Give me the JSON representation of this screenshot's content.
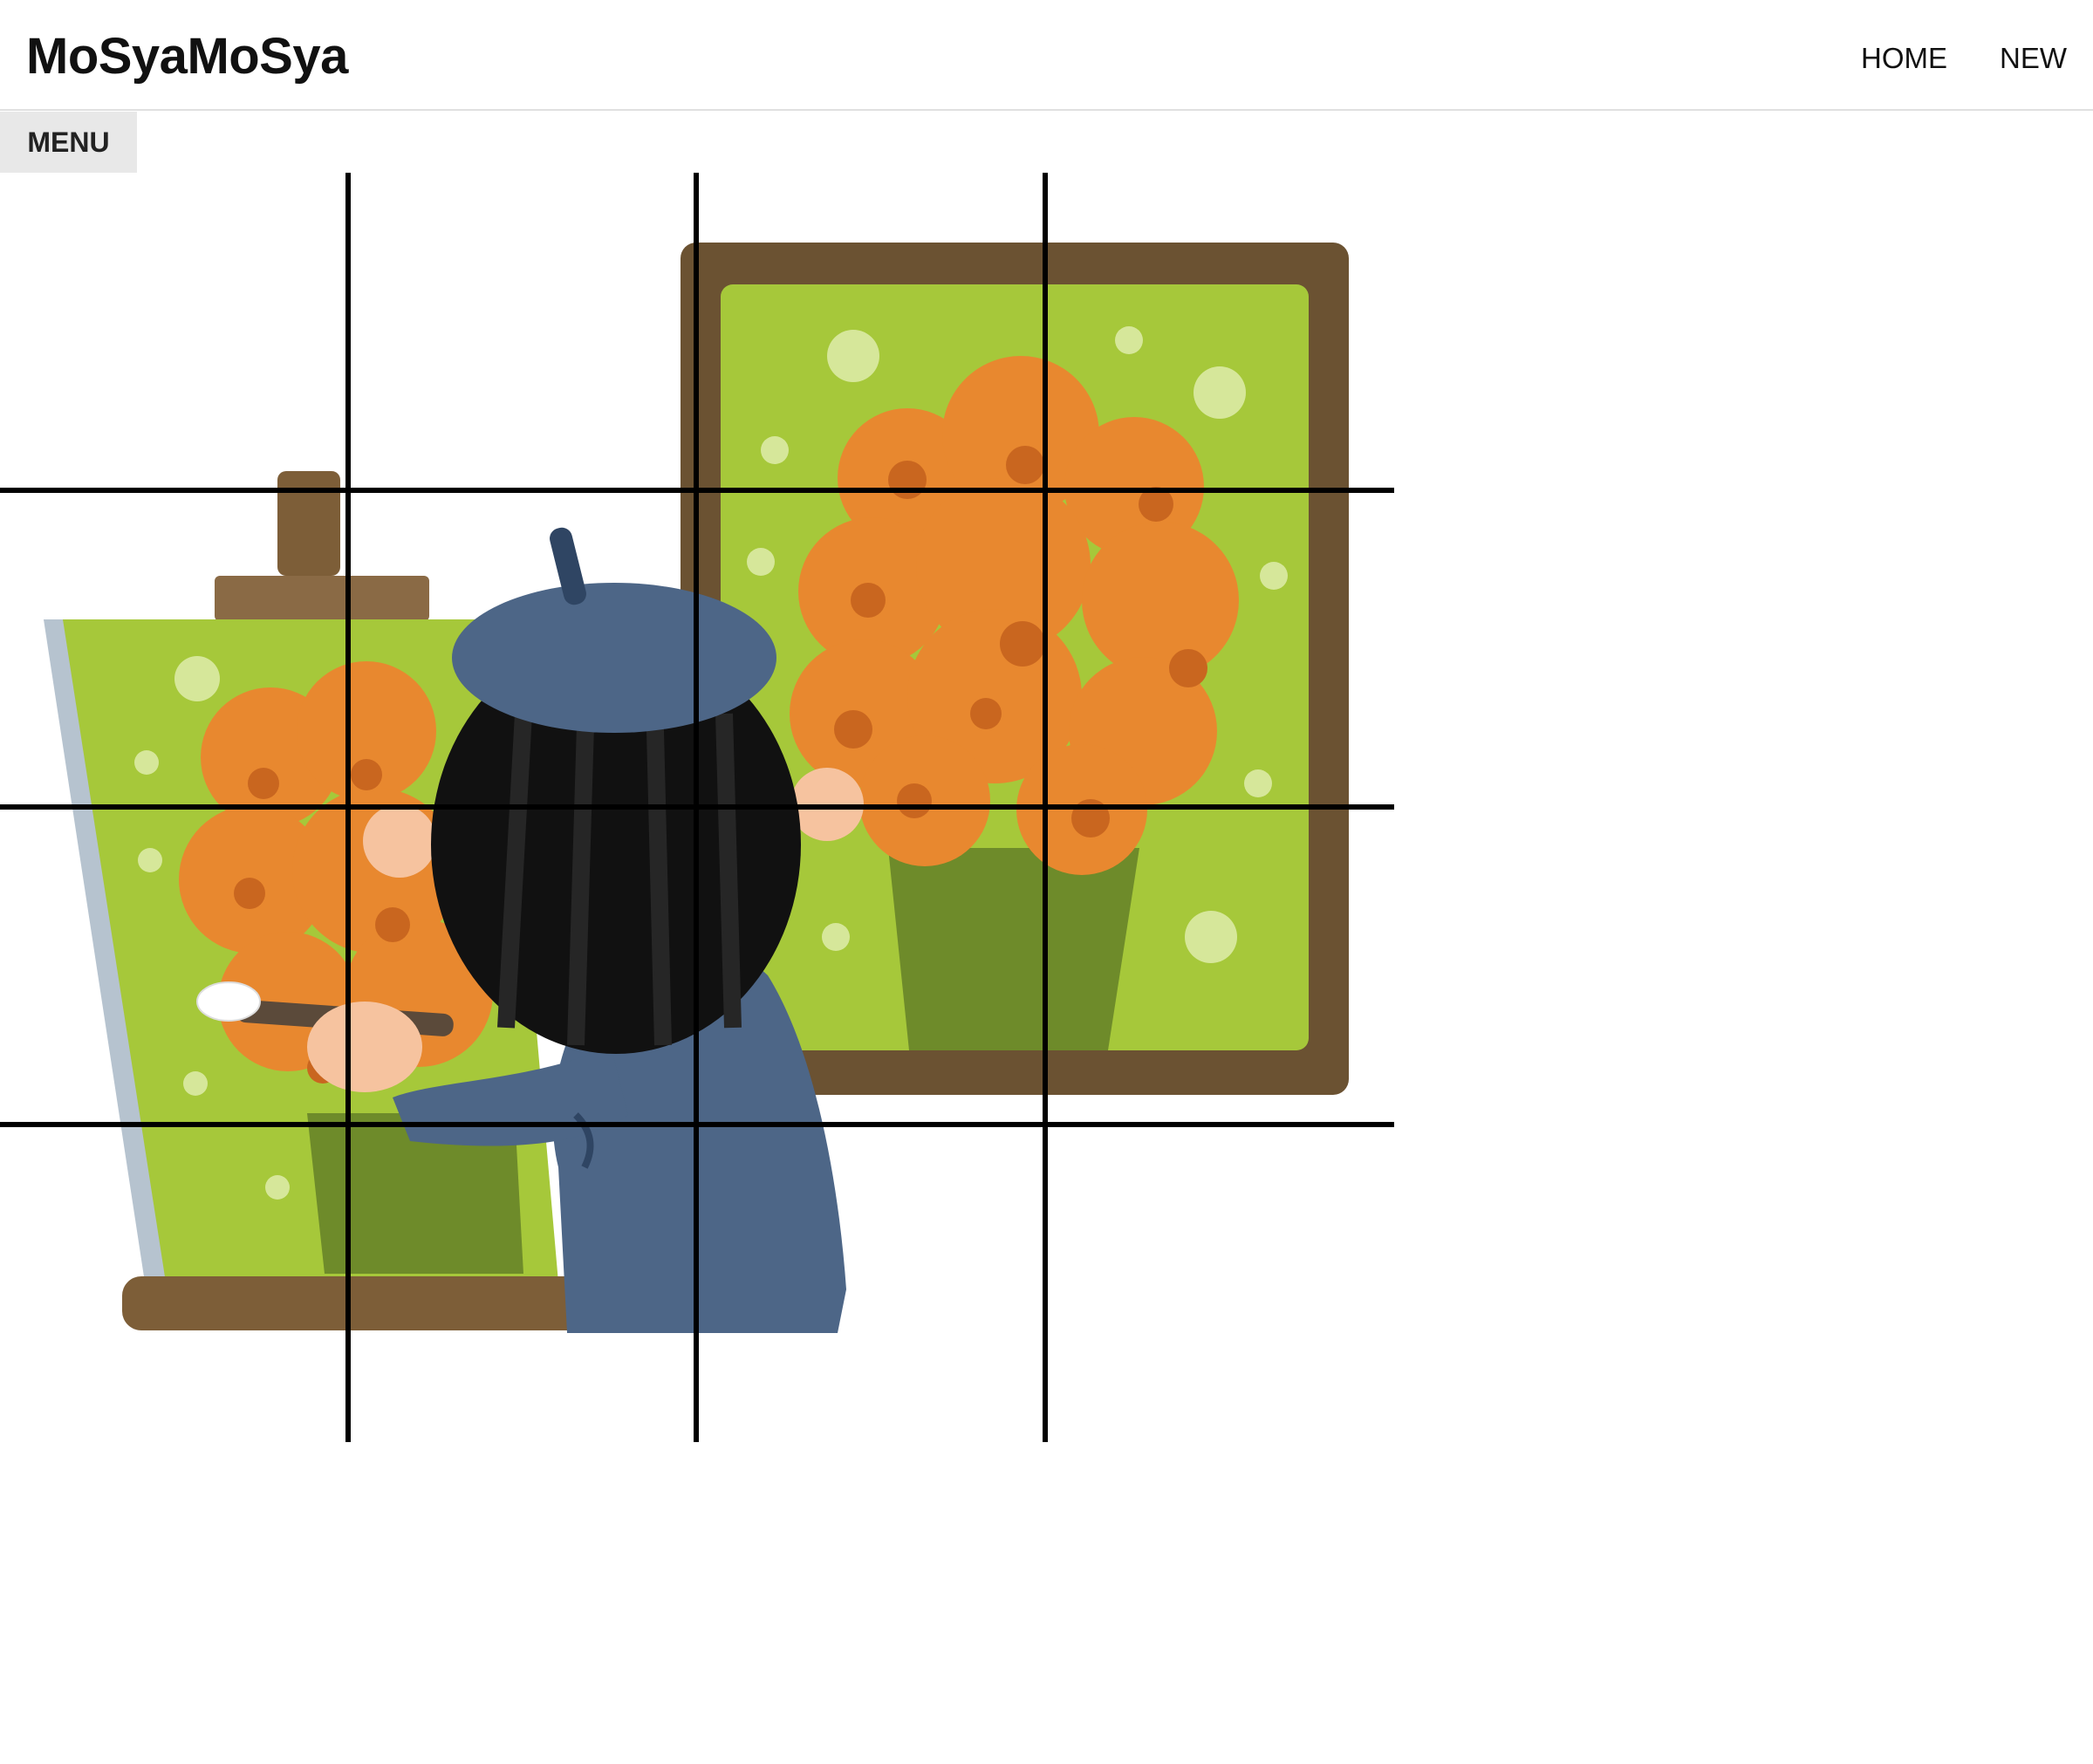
{
  "header": {
    "brand": "MoSyaMoSya",
    "nav": [
      {
        "label": "HOME"
      },
      {
        "label": "NEW"
      }
    ]
  },
  "menu": {
    "label": "MENU"
  },
  "drawing": {
    "subject": "illustration of an artist in a beret painting orange flowers on an easel canvas",
    "grid": {
      "columns": 4,
      "rows": 4
    }
  }
}
